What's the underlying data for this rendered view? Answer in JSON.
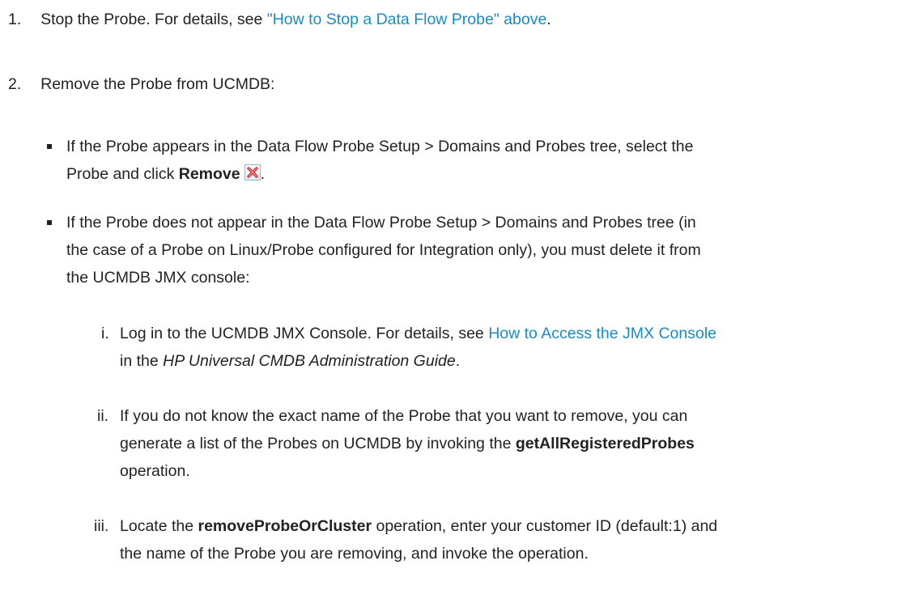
{
  "steps": [
    {
      "number": "1.",
      "text_before": "Stop the Probe. For details, see ",
      "link": "\"How to Stop a Data Flow Probe\" above",
      "text_after": "."
    },
    {
      "number": "2.",
      "text": "Remove the Probe from UCMDB:"
    }
  ],
  "bullets": [
    {
      "line1": "If the Probe appears in the Data Flow Probe Setup > Domains and Probes tree, select the",
      "line2_before": "Probe and click ",
      "line2_bold": "Remove",
      "line2_after": "."
    },
    {
      "line1": "If the Probe does not appear in the Data Flow Probe Setup > Domains and Probes tree (in",
      "line2": "the case of a Probe on Linux/Probe configured for Integration only), you must delete it from",
      "line3": "the UCMDB JMX console:"
    }
  ],
  "substeps": [
    {
      "number": "i.",
      "line1_before": "Log in to the UCMDB JMX Console. For details, see ",
      "line1_link": "How to Access the JMX Console",
      "line2_before": "in the ",
      "line2_italic": "HP Universal CMDB Administration Guide",
      "line2_after": "."
    },
    {
      "number": "ii.",
      "line1": "If you do not know the exact name of the Probe that you want to remove, you can",
      "line2_before": "generate a list of the Probes on UCMDB by invoking the ",
      "line2_bold": "getAllRegisteredProbes",
      "line3": "operation."
    },
    {
      "number": "iii.",
      "line1_before": "Locate the ",
      "line1_bold": "removeProbeOrCluster",
      "line1_after": " operation, enter your customer ID (default:1) and",
      "line2": "the name of the Probe you are removing, and invoke the operation."
    }
  ],
  "icons": {
    "remove": "remove-icon"
  },
  "colors": {
    "text": "#222222",
    "link": "#1a8bc2",
    "remove_icon_x": "#d9272e"
  }
}
